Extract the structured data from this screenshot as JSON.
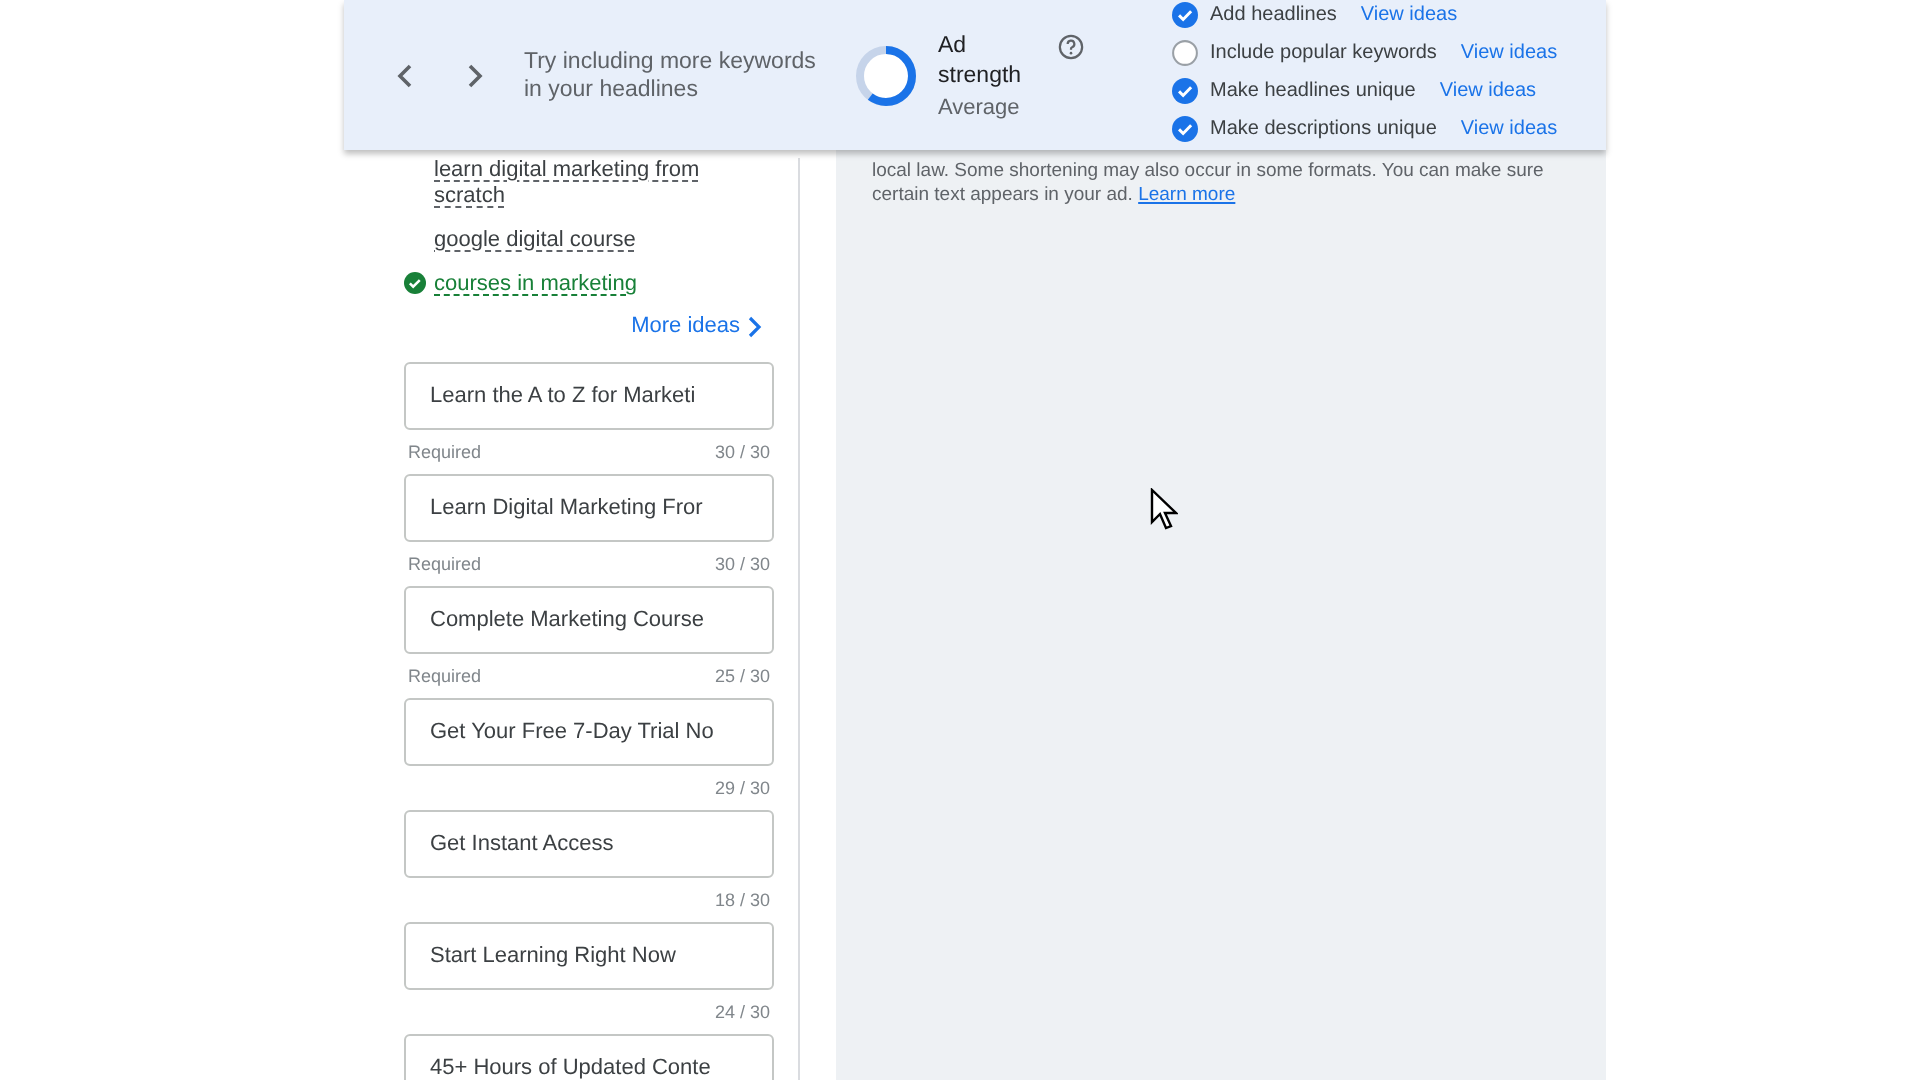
{
  "banner": {
    "message": "Try including more keywords in your headlines",
    "strength": {
      "title": "Ad strength",
      "rating": "Average",
      "level": 0.6
    },
    "checklist": [
      {
        "label": "Add headlines",
        "checked": true,
        "link": "View ideas"
      },
      {
        "label": "Include popular keywords",
        "checked": false,
        "link": "View ideas"
      },
      {
        "label": "Make headlines unique",
        "checked": true,
        "link": "View ideas"
      },
      {
        "label": "Make descriptions unique",
        "checked": true,
        "link": "View ideas"
      }
    ]
  },
  "keyword_ideas": {
    "items": [
      {
        "text": "learn digital marketing from scratch",
        "added": false
      },
      {
        "text": "google digital course",
        "added": false
      },
      {
        "text": "courses in marketing",
        "added": true
      }
    ],
    "more": "More ideas"
  },
  "headlines": [
    {
      "value": "Learn the A to Z for Marketi",
      "hint": "Required",
      "count": "30 / 30"
    },
    {
      "value": "Learn Digital Marketing Fror",
      "hint": "Required",
      "count": "30 / 30"
    },
    {
      "value": "Complete Marketing Course",
      "hint": "Required",
      "count": "25 / 30"
    },
    {
      "value": "Get Your Free 7-Day Trial No",
      "count": "29 / 30"
    },
    {
      "value": "Get Instant Access",
      "count": "18 / 30"
    },
    {
      "value": "Start Learning Right Now",
      "count": "24 / 30"
    },
    {
      "value": "45+ Hours of Updated Conte"
    }
  ],
  "note": {
    "text": "local law. Some shortening may also occur in some formats. You can make sure certain text appears in your ad.",
    "link": "Learn more"
  }
}
